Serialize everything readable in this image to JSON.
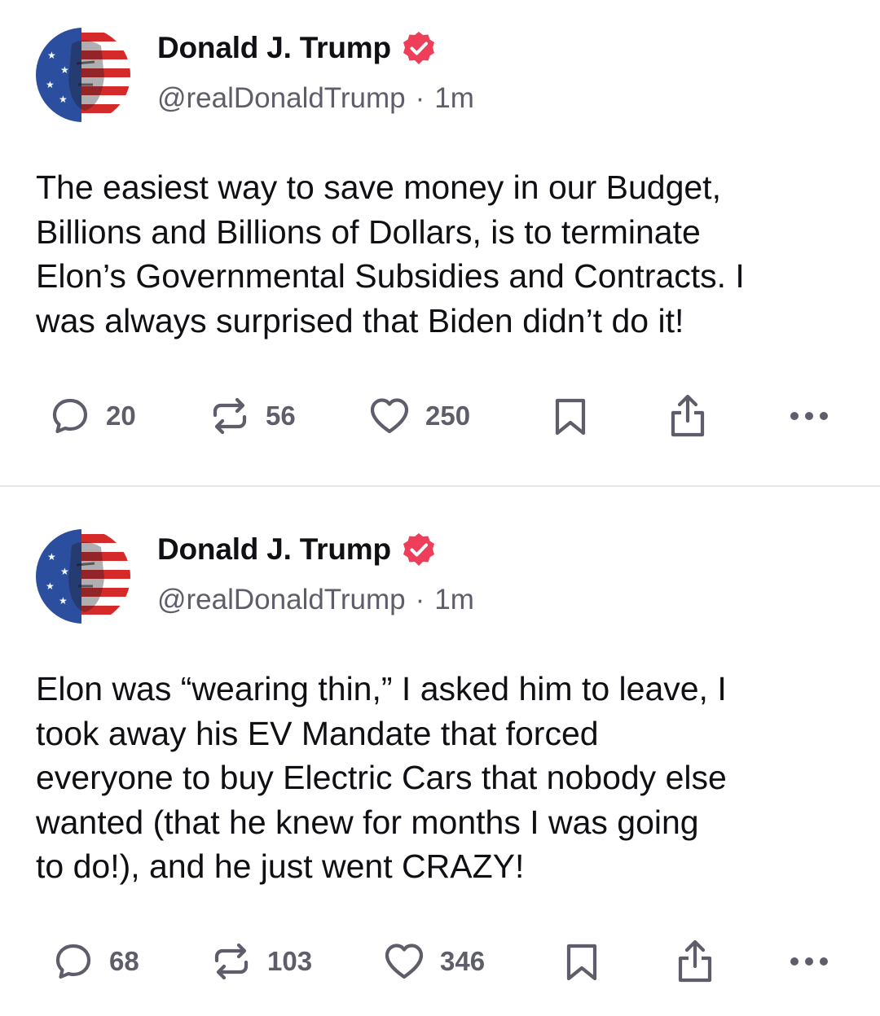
{
  "posts": [
    {
      "author": {
        "display_name": "Donald J. Trump",
        "handle": "@realDonaldTrump",
        "verified": true,
        "avatar_icon": "flag-face-avatar"
      },
      "time": "1m",
      "separator": "·",
      "text": "The easiest way to save money in our Budget,\nBillions and Billions of Dollars, is to terminate\nElon’s Governmental Subsidies and Contracts. I\nwas always surprised that Biden didn’t do it!",
      "stats": {
        "replies": "20",
        "reposts": "56",
        "likes": "250"
      }
    },
    {
      "author": {
        "display_name": "Donald J. Trump",
        "handle": "@realDonaldTrump",
        "verified": true,
        "avatar_icon": "flag-face-avatar"
      },
      "time": "1m",
      "separator": "·",
      "text": "Elon was “wearing thin,” I asked him to leave, I\ntook away his EV Mandate that forced\neveryone to buy Electric Cars that nobody else\nwanted (that he knew for months I was going\nto do!), and he just went CRAZY!",
      "stats": {
        "replies": "68",
        "reposts": "103",
        "likes": "346"
      }
    }
  ],
  "icons": {
    "reply": "reply-icon",
    "repost": "repost-icon",
    "like": "heart-icon",
    "bookmark": "bookmark-icon",
    "share": "share-icon",
    "more": "more-icon",
    "verified": "verified-badge-icon"
  },
  "colors": {
    "text": "#0f0f14",
    "muted": "#5e5e6b",
    "verified_badge": "#ef3e59",
    "divider": "#e7e6ec"
  }
}
